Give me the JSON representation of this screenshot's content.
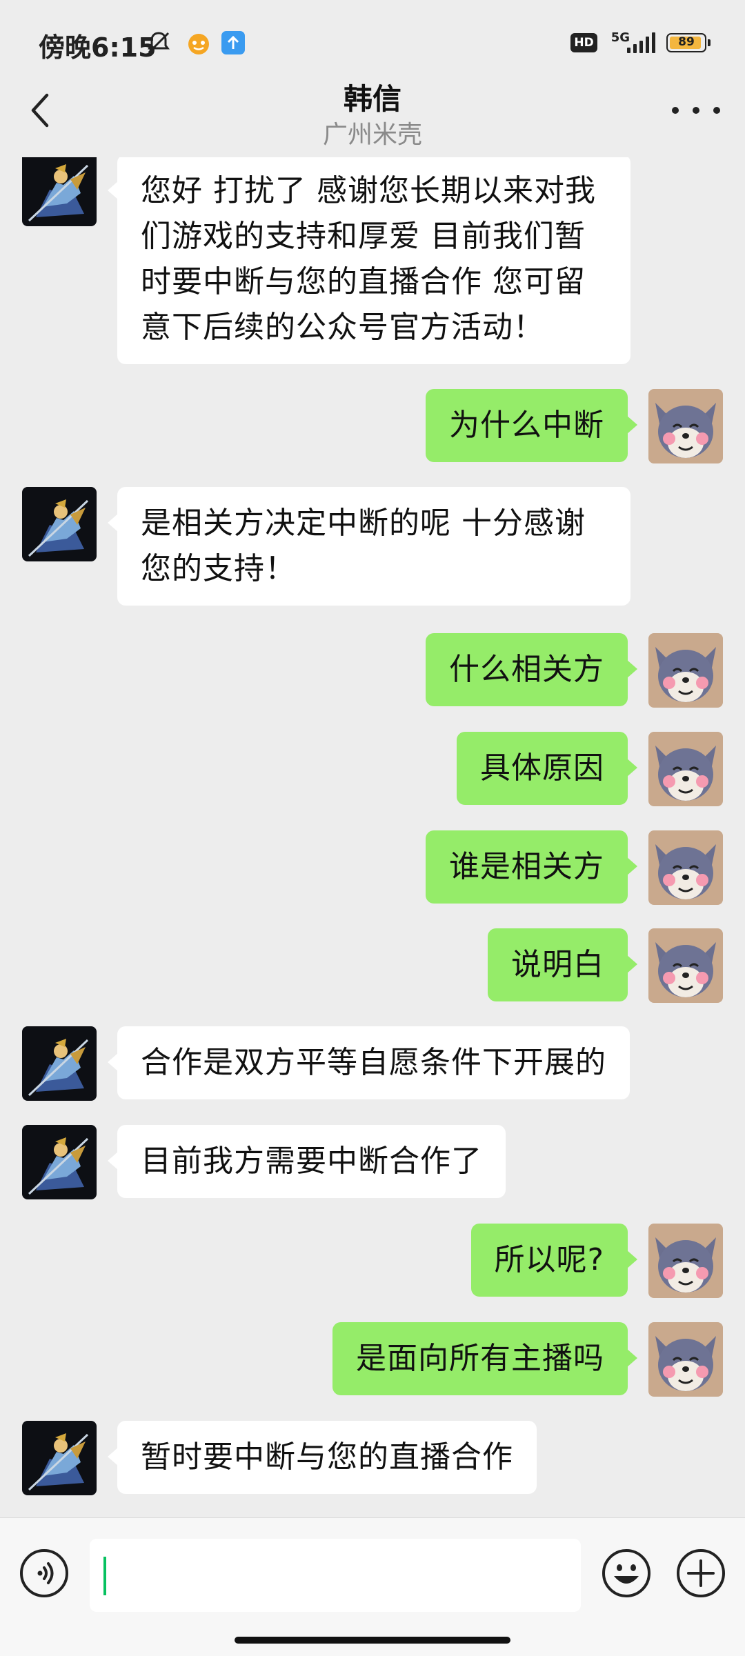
{
  "status_bar": {
    "time": "傍晚6:15",
    "hd": "HD",
    "network": "5G",
    "battery": "89"
  },
  "header": {
    "title": "韩信",
    "subtitle": "广州米壳"
  },
  "colors": {
    "background": "#ededed",
    "bubble_self": "#95ec69",
    "bubble_other": "#ffffff",
    "caret": "#07c160"
  },
  "messages": [
    {
      "side": "left",
      "text": "您好 打扰了 感谢您长期以来对我们游戏的支持和厚爱  目前我们暂时要中断与您的直播合作 您可留意下后续的公众号官方活动！"
    },
    {
      "side": "right",
      "text": "为什么中断"
    },
    {
      "side": "left",
      "text": "是相关方决定中断的呢 十分感谢您的支持！"
    },
    {
      "side": "right",
      "text": "什么相关方"
    },
    {
      "side": "right",
      "text": "具体原因"
    },
    {
      "side": "right",
      "text": "谁是相关方"
    },
    {
      "side": "right",
      "text": "说明白"
    },
    {
      "side": "left",
      "text": "合作是双方平等自愿条件下开展的"
    },
    {
      "side": "left",
      "text": "目前我方需要中断合作了"
    },
    {
      "side": "right",
      "text": "所以呢?"
    },
    {
      "side": "right",
      "text": "是面向所有主播吗"
    },
    {
      "side": "left",
      "text": "暂时要中断与您的直播合作"
    }
  ],
  "input_bar": {
    "value": "",
    "icons": [
      "voice-icon",
      "emoji-icon",
      "plus-icon"
    ]
  }
}
